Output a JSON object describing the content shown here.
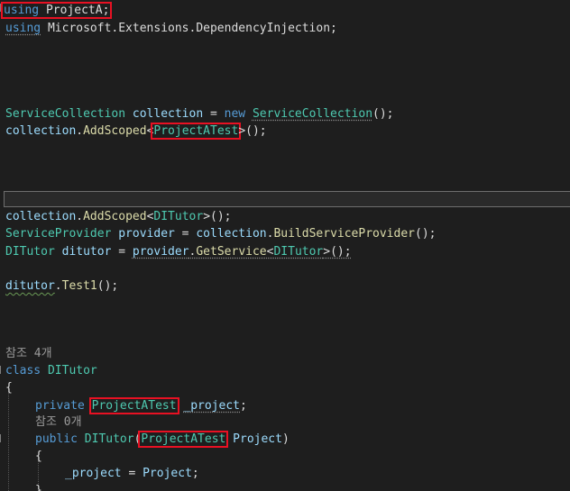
{
  "lines": {
    "l1": {
      "kw": "using",
      "ns": "ProjectA",
      "semi": ";"
    },
    "l2": {
      "kw": "using",
      "ns": "Microsoft.Extensions.DependencyInjection;"
    },
    "l3": {
      "type1": "ServiceCollection",
      "var": "collection",
      "eq": " = ",
      "kw": "new",
      "type2": "ServiceCollection",
      "tail": "();"
    },
    "l4": {
      "obj": "collection",
      "dot": ".",
      "method": "AddScoped",
      "lt": "<",
      "type": "ProjectATest",
      "tail": ">();"
    },
    "l5": {
      "obj": "collection",
      "dot": ".",
      "method": "AddScoped",
      "lt": "<",
      "type": "DITutor",
      "tail": ">();"
    },
    "l6": {
      "type": "ServiceProvider",
      "var": "provider",
      "eq": " = ",
      "obj": "collection",
      "dot": ".",
      "method": "BuildServiceProvider",
      "tail": "();"
    },
    "l7": {
      "type": "DITutor",
      "var": "ditutor",
      "eq": " = ",
      "obj": "provider",
      "dot": ".",
      "method": "GetService",
      "lt": "<",
      "type2": "DITutor",
      "tail": ">();"
    },
    "l8": {
      "obj": "ditutor",
      "dot": ".",
      "method": "Test1",
      "tail": "();"
    },
    "l9": {
      "ref": "참조 4개"
    },
    "l10": {
      "kw": "class",
      "type": "DITutor"
    },
    "l11": {
      "brace": "{"
    },
    "l12": {
      "kw": "private",
      "type": "ProjectATest",
      "field": "_project",
      "semi": ";"
    },
    "l13": {
      "ref": "참조 0개"
    },
    "l14": {
      "kw": "public",
      "ctor": "DITutor",
      "lp": "(",
      "type": "ProjectATest",
      "param": "Project",
      "rp": ")"
    },
    "l15": {
      "brace": "{"
    },
    "l16": {
      "field": "_project",
      "eq": " = ",
      "param": "Project",
      "semi": ";"
    },
    "l17": {
      "brace": "}"
    }
  },
  "colors": {
    "background": "#1e1e1e",
    "keyword": "#569cd6",
    "type": "#4ec9b0",
    "method": "#dcdcaa",
    "variable": "#9cdcfe",
    "highlight_box": "#e81123"
  }
}
